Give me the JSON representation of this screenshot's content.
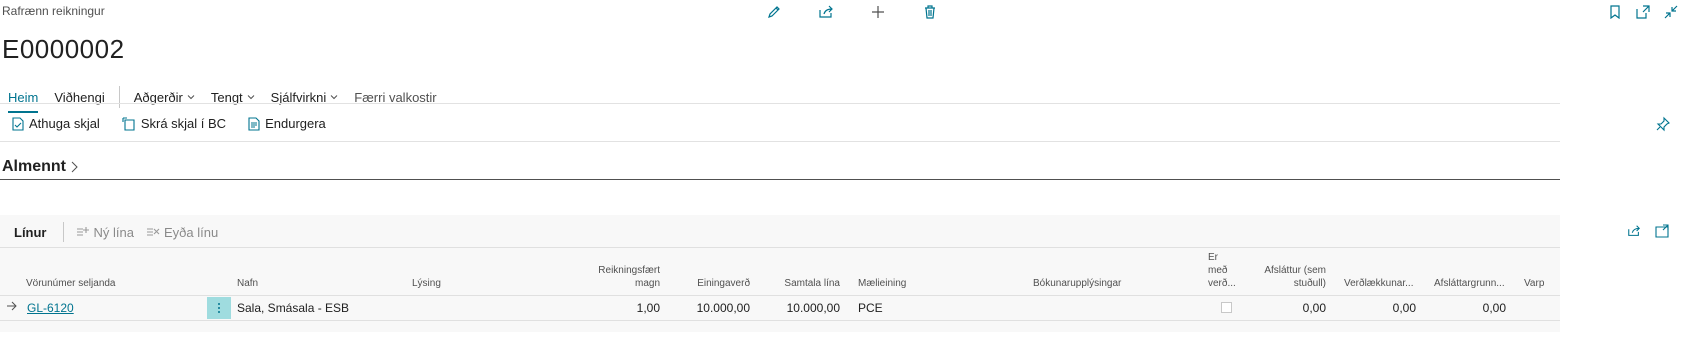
{
  "header": {
    "doc_type": "Rafrænn reikningur",
    "doc_number": "E0000002",
    "top_icons": [
      "pencil-icon",
      "share-icon",
      "plus-icon",
      "trash-icon"
    ],
    "right_icons": [
      "bookmark-icon",
      "open-new-window-icon",
      "collapse-icon"
    ]
  },
  "tabs": [
    {
      "label": "Heim",
      "active": true
    },
    {
      "label": "Viðhengi"
    },
    {
      "label": "Aðgerðir",
      "dropdown": true
    },
    {
      "label": "Tengt",
      "dropdown": true
    },
    {
      "label": "Sjálfvirkni",
      "dropdown": true
    },
    {
      "label": "Færri valkostir"
    }
  ],
  "actions": [
    {
      "label": "Athuga skjal",
      "icon": "document-check-icon"
    },
    {
      "label": "Skrá skjal í BC",
      "icon": "document-register-icon"
    },
    {
      "label": "Endurgera",
      "icon": "document-rebuild-icon"
    }
  ],
  "section": {
    "title": "Almennt"
  },
  "lines": {
    "title": "Línur",
    "new_line": "Ný lína",
    "delete_line": "Eyða línu",
    "columns": {
      "vendor_item_no": "Vörunúmer seljanda",
      "name": "Nafn",
      "description": "Lýsing",
      "invoiced_qty_1": "Reikningsfært",
      "invoiced_qty_2": "magn",
      "unit_price": "Einingaverð",
      "line_total": "Samtala lína",
      "uom": "Mælieining",
      "posting_info": "Bókunarupplýsingar",
      "incl_vat_1": "Er",
      "incl_vat_2": "með",
      "incl_vat_3": "verð...",
      "discount_1": "Afsláttur (sem",
      "discount_2": "stuðull)",
      "price_increase": "Verðlækkunar...",
      "discount_reason": "Afsláttargrunn...",
      "more": "Varp"
    },
    "rows": [
      {
        "vendor_item_no": "GL-6120",
        "name": "Sala, Smásala - ESB",
        "description": "",
        "invoiced_qty": "1,00",
        "unit_price": "10.000,00",
        "line_total": "10.000,00",
        "uom": "PCE",
        "posting_info": "",
        "incl_vat": false,
        "discount": "0,00",
        "price_increase": "0,00",
        "discount_reason": "0,00"
      }
    ]
  },
  "colors": {
    "accent": "#00748f",
    "row_menu": "#9fdcdf"
  }
}
